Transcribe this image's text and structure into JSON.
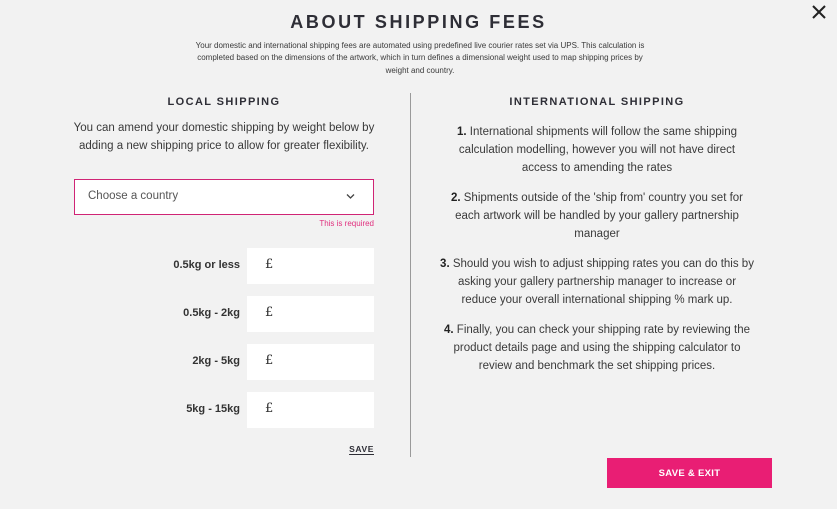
{
  "modal": {
    "title": "ABOUT SHIPPING FEES",
    "intro": "Your domestic and international shipping fees are automated using predefined live courier rates set via UPS. This calculation is completed based on the dimensions of the artwork, which in turn defines a dimensional weight used to map shipping prices by weight and country.",
    "close_icon": "close-icon"
  },
  "local": {
    "heading": "LOCAL SHIPPING",
    "description": "You can amend your domestic shipping by weight below by adding a new shipping price to allow for greater flexibility.",
    "country_select": {
      "placeholder": "Choose a country",
      "value": "",
      "icon": "chevron-down-icon"
    },
    "required_message": "This is required",
    "currency_symbol": "£",
    "weights": [
      {
        "label": "0.5kg or less",
        "value": ""
      },
      {
        "label": "0.5kg - 2kg",
        "value": ""
      },
      {
        "label": "2kg - 5kg",
        "value": ""
      },
      {
        "label": "5kg - 15kg",
        "value": ""
      }
    ],
    "save_label": "SAVE"
  },
  "international": {
    "heading": "INTERNATIONAL SHIPPING",
    "items": [
      {
        "num": "1.",
        "text": "International shipments will follow the same shipping calculation modelling, however you will not have direct access to amending the rates"
      },
      {
        "num": "2.",
        "text": "Shipments outside of the 'ship from' country you set for each artwork will be handled by your gallery partnership manager"
      },
      {
        "num": "3.",
        "text": "Should you wish to adjust shipping rates you can do this by asking your gallery partnership manager to increase or reduce your overall international shipping % mark up."
      },
      {
        "num": "4.",
        "text": "Finally, you can check your shipping rate by reviewing the product details page and using the shipping calculator to review and benchmark the set shipping prices."
      }
    ]
  },
  "footer": {
    "save_exit_label": "SAVE & EXIT"
  },
  "colors": {
    "accent": "#e91e74",
    "error": "#e0307e",
    "background": "#f2f2f2",
    "heading": "#2e2e36"
  }
}
